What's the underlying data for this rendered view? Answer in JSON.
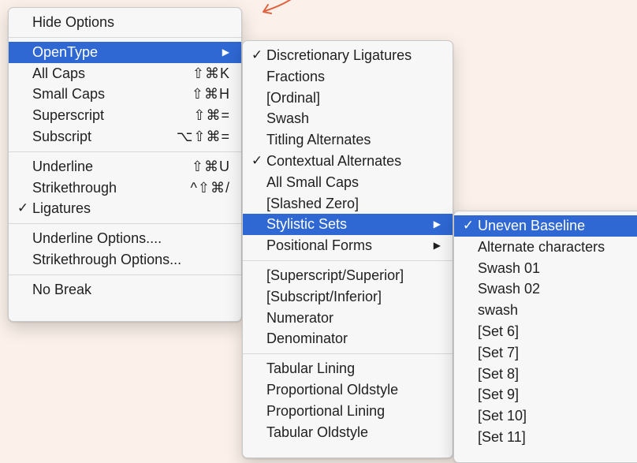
{
  "main_menu": {
    "items": [
      {
        "label": "Hide Options"
      },
      {
        "sep": true
      },
      {
        "label": "OpenType",
        "active": true,
        "arrow": "▶"
      },
      {
        "label": "All Caps",
        "shortcut": "⇧⌘K"
      },
      {
        "label": "Small Caps",
        "shortcut": "⇧⌘H"
      },
      {
        "label": "Superscript",
        "shortcut": "⇧⌘="
      },
      {
        "label": "Subscript",
        "shortcut": "⌥⇧⌘="
      },
      {
        "sep": true
      },
      {
        "label": "Underline",
        "shortcut": "⇧⌘U"
      },
      {
        "label": "Strikethrough",
        "shortcut": "^⇧⌘/"
      },
      {
        "label": "Ligatures",
        "check": "✓"
      },
      {
        "sep": true
      },
      {
        "label": "Underline Options...."
      },
      {
        "label": "Strikethrough Options..."
      },
      {
        "sep": true
      },
      {
        "label": "No Break"
      }
    ]
  },
  "opentype_menu": {
    "items": [
      {
        "label": "Discretionary Ligatures",
        "check": "✓"
      },
      {
        "label": "Fractions"
      },
      {
        "label": "[Ordinal]"
      },
      {
        "label": "Swash"
      },
      {
        "label": "Titling Alternates"
      },
      {
        "label": "Contextual Alternates",
        "check": "✓"
      },
      {
        "label": "All Small Caps"
      },
      {
        "label": "[Slashed Zero]"
      },
      {
        "label": "Stylistic Sets",
        "active": true,
        "arrow": "▶"
      },
      {
        "label": "Positional Forms",
        "arrow": "▶"
      },
      {
        "sep": true
      },
      {
        "label": "[Superscript/Superior]"
      },
      {
        "label": "[Subscript/Inferior]"
      },
      {
        "label": "Numerator"
      },
      {
        "label": "Denominator"
      },
      {
        "sep": true
      },
      {
        "label": "Tabular Lining"
      },
      {
        "label": "Proportional Oldstyle"
      },
      {
        "label": "Proportional Lining"
      },
      {
        "label": "Tabular Oldstyle"
      }
    ]
  },
  "stylistic_sets_menu": {
    "items": [
      {
        "label": "Uneven Baseline",
        "check": "✓",
        "active": true
      },
      {
        "label": "Alternate characters"
      },
      {
        "label": "Swash 01"
      },
      {
        "label": "Swash 02"
      },
      {
        "label": "swash"
      },
      {
        "label": "[Set 6]"
      },
      {
        "label": "[Set 7]"
      },
      {
        "label": "[Set 8]"
      },
      {
        "label": "[Set 9]"
      },
      {
        "label": "[Set 10]"
      },
      {
        "label": "[Set 11]"
      }
    ]
  },
  "colors": {
    "highlight": "#2f68d3",
    "background": "#fbf1ea",
    "menu_bg": "#f7f7f7",
    "arrow_annotation": "#e0633f"
  },
  "icons": {
    "checkmark": "checkmark-icon",
    "submenu": "submenu-arrow-icon",
    "annotation": "annotation-arrow-icon"
  }
}
